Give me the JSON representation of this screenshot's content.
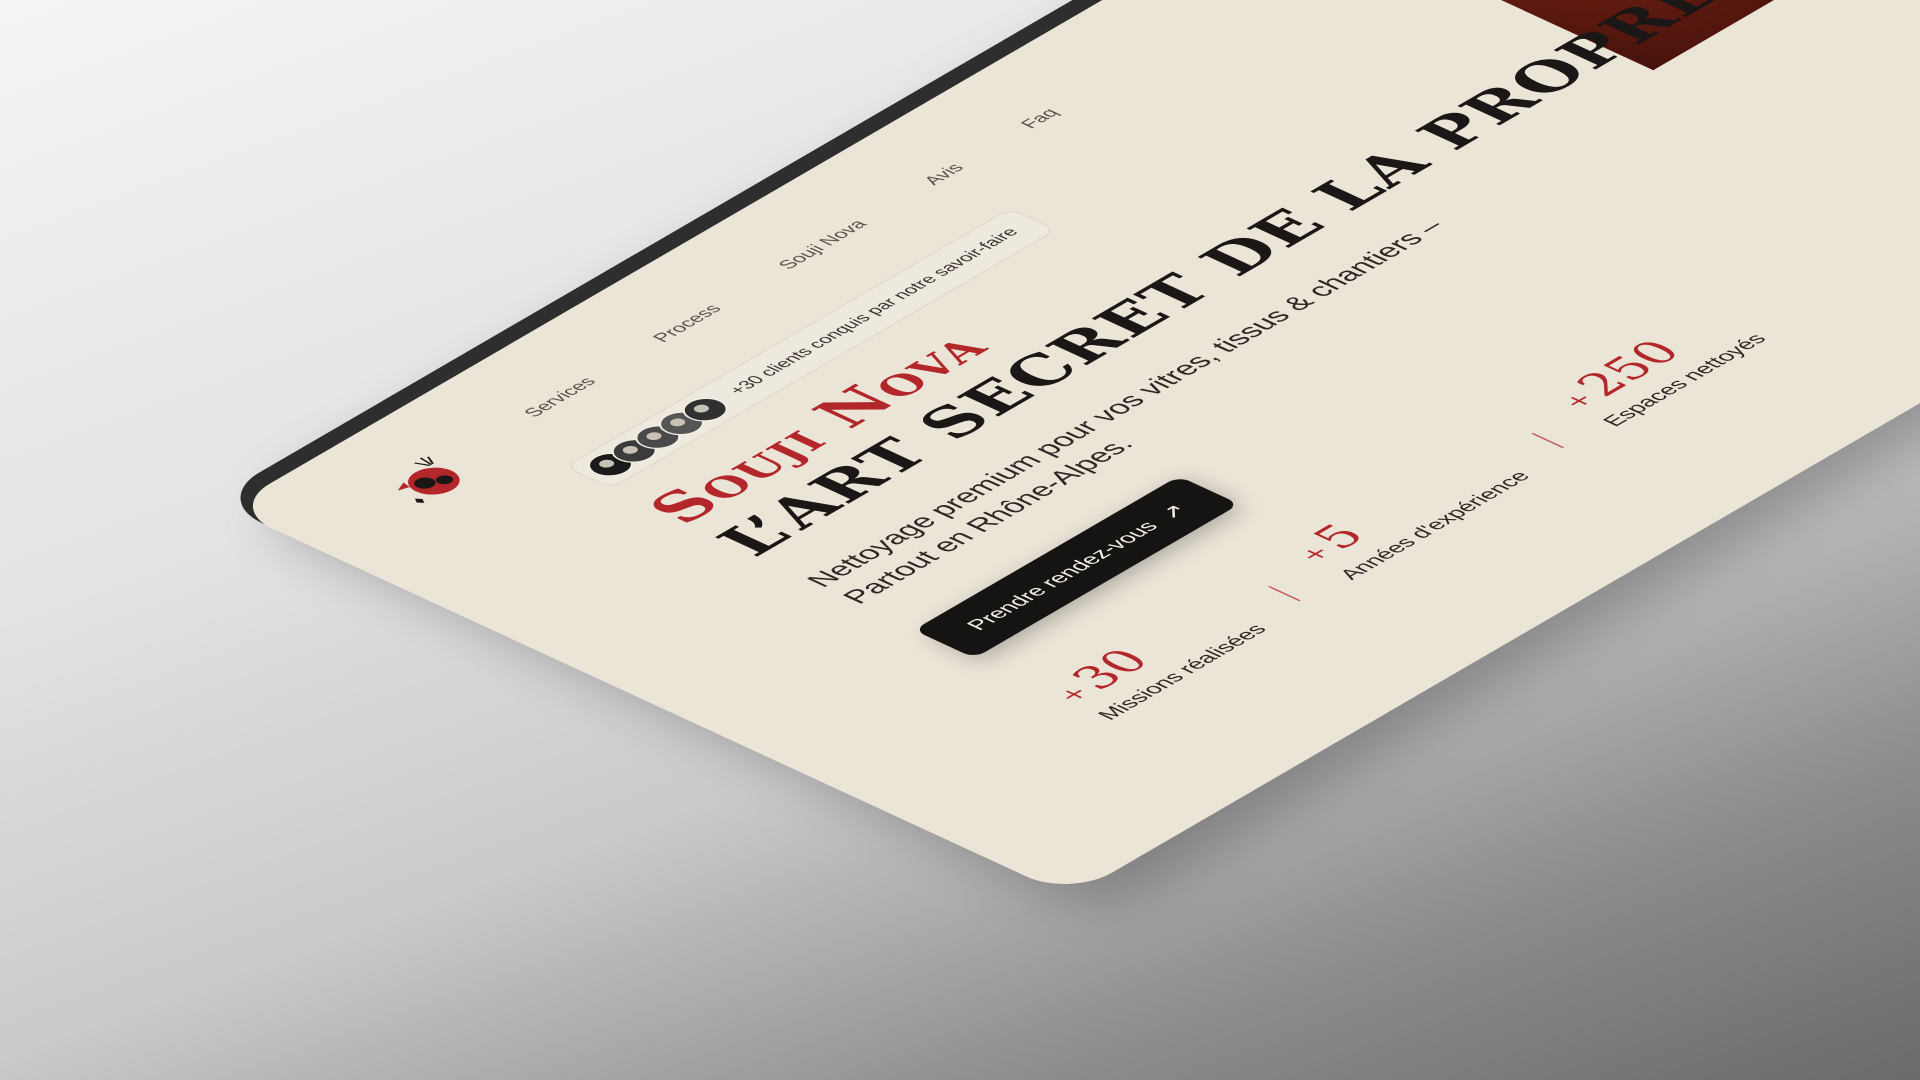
{
  "header": {
    "logo": "souji-nova-logo",
    "nav": [
      {
        "label": "Services"
      },
      {
        "label": "Process"
      },
      {
        "label": "Souji Nova"
      },
      {
        "label": "Avis"
      },
      {
        "label": "Faq"
      }
    ]
  },
  "badge": {
    "text": "+30 clients conquis par notre savoir-faire",
    "avatar_count": 5
  },
  "hero": {
    "brand": "Souji Nova",
    "headline": "L’ART SECRET DE LA PROPRETÉ",
    "subtitle_line1": "Nettoyage premium pour vos vitres, tissus & chantiers –",
    "subtitle_line2": "Partout en Rhône-Alpes.",
    "cta_label": "Prendre rendez-vous",
    "cta_icon": "arrow-right-icon"
  },
  "stats": [
    {
      "plus": "+",
      "value": "30",
      "label": "Missions réalisées"
    },
    {
      "plus": "+",
      "value": "5",
      "label": "Années d'expérience"
    },
    {
      "plus": "+",
      "value": "250",
      "label": "Espaces nettoyés"
    }
  ],
  "colors": {
    "accent": "#b3262a",
    "background": "#ebe5d8",
    "dark": "#151413"
  }
}
